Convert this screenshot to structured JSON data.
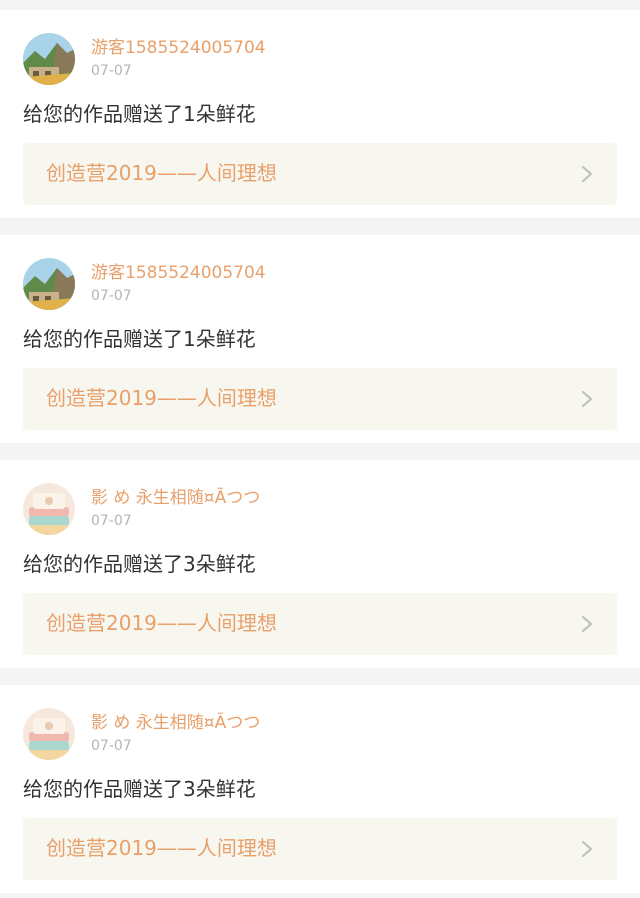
{
  "colors": {
    "accent": "#e8a06b",
    "date": "#b5b5b5",
    "text": "#333333",
    "link_bg": "#f7f6ef",
    "page_bg": "#f4f4f4"
  },
  "notifications": [
    {
      "avatar_icon": "landscape-avatar-icon",
      "username": "游客1585524005704",
      "date": "07-07",
      "message": "给您的作品赠送了1朵鲜花",
      "work_title": "创造营2019——人间理想"
    },
    {
      "avatar_icon": "landscape-avatar-icon",
      "username": "游客1585524005704",
      "date": "07-07",
      "message": "给您的作品赠送了1朵鲜花",
      "work_title": "创造营2019——人间理想"
    },
    {
      "avatar_icon": "pastel-avatar-icon",
      "username": "影 め 永生相随¤Ãつつ",
      "date": "07-07",
      "message": "给您的作品赠送了3朵鲜花",
      "work_title": "创造营2019——人间理想"
    },
    {
      "avatar_icon": "pastel-avatar-icon",
      "username": "影 め 永生相随¤Ãつつ",
      "date": "07-07",
      "message": "给您的作品赠送了3朵鲜花",
      "work_title": "创造营2019——人间理想"
    }
  ]
}
